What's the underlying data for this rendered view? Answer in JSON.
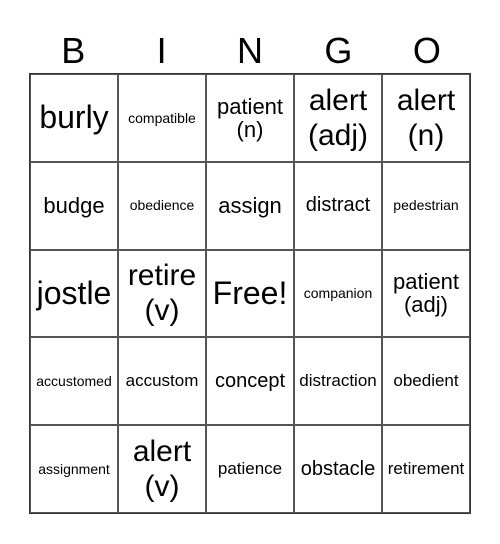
{
  "header": [
    "B",
    "I",
    "N",
    "G",
    "O"
  ],
  "cells": [
    {
      "text": "burly",
      "size": "s1"
    },
    {
      "text": "compatible",
      "size": "s5"
    },
    {
      "text": "patient\n(n)",
      "size": "s3"
    },
    {
      "text": "alert\n(adj)",
      "size": "s2"
    },
    {
      "text": "alert\n(n)",
      "size": "s2"
    },
    {
      "text": "budge",
      "size": "s3"
    },
    {
      "text": "obedience",
      "size": "s5"
    },
    {
      "text": "assign",
      "size": "s3"
    },
    {
      "text": "distract",
      "size": "s4"
    },
    {
      "text": "pedestrian",
      "size": "s5"
    },
    {
      "text": "jostle",
      "size": "s1"
    },
    {
      "text": "retire\n(v)",
      "size": "s2"
    },
    {
      "text": "Free!",
      "size": "s1"
    },
    {
      "text": "companion",
      "size": "s5"
    },
    {
      "text": "patient\n(adj)",
      "size": "s3"
    },
    {
      "text": "accustomed",
      "size": "s5"
    },
    {
      "text": "accustom",
      "size": "s6"
    },
    {
      "text": "concept",
      "size": "s4"
    },
    {
      "text": "distraction",
      "size": "s6"
    },
    {
      "text": "obedient",
      "size": "s6"
    },
    {
      "text": "assignment",
      "size": "s5"
    },
    {
      "text": "alert\n(v)",
      "size": "s2"
    },
    {
      "text": "patience",
      "size": "s6"
    },
    {
      "text": "obstacle",
      "size": "s4"
    },
    {
      "text": "retirement",
      "size": "s6"
    }
  ]
}
